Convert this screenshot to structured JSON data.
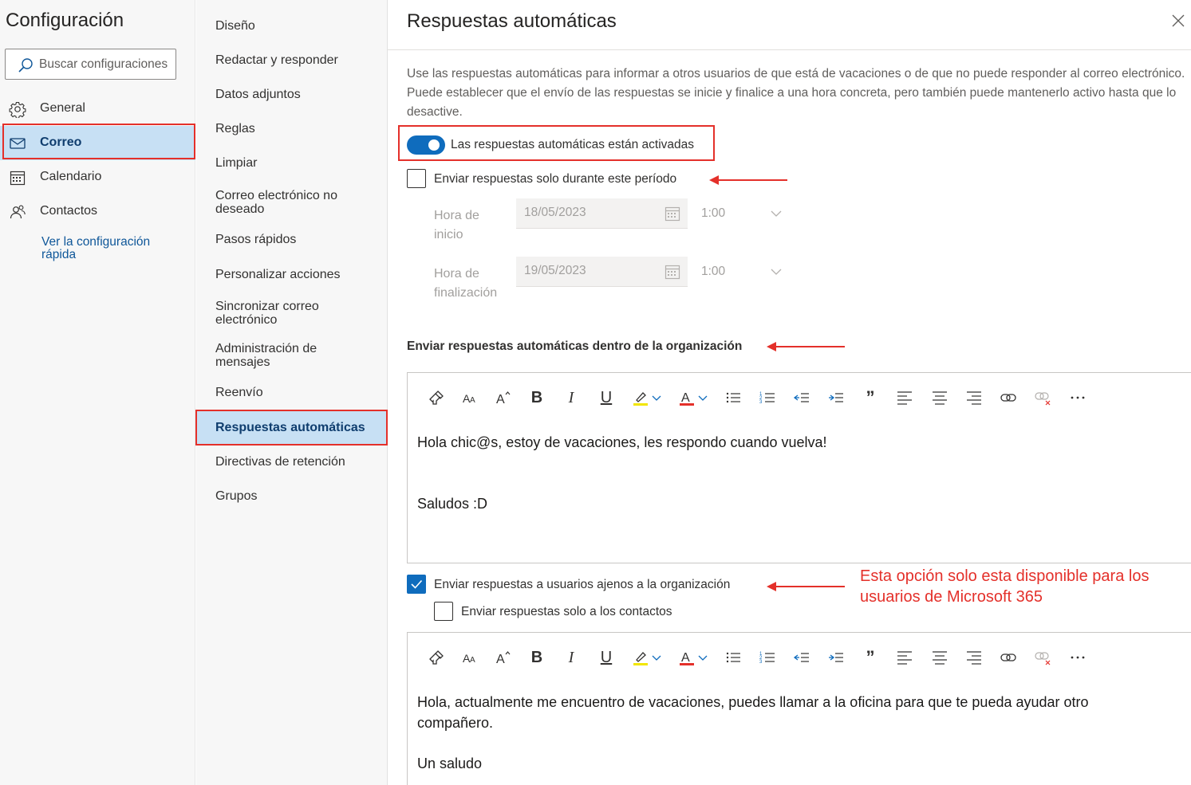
{
  "left": {
    "title": "Configuración",
    "search_placeholder": "Buscar configuraciones",
    "categories": [
      {
        "label": "General",
        "icon": "gear-icon"
      },
      {
        "label": "Correo",
        "icon": "mail-icon"
      },
      {
        "label": "Calendario",
        "icon": "calendar-icon"
      },
      {
        "label": "Contactos",
        "icon": "people-icon"
      }
    ],
    "quick_link": "Ver la configuración rápida"
  },
  "middle": {
    "items": [
      "Diseño",
      "Redactar y responder",
      "Datos adjuntos",
      "Reglas",
      "Limpiar",
      "Correo electrónico no deseado",
      "Pasos rápidos",
      "Personalizar acciones",
      "Sincronizar correo electrónico",
      "Administración de mensajes",
      "Reenvío",
      "Respuestas automáticas",
      "Directivas de retención",
      "Grupos"
    ]
  },
  "right": {
    "title": "Respuestas automáticas",
    "intro": "Use las respuestas automáticas para informar a otros usuarios de que está de vacaciones o de que no puede responder al correo electrónico. Puede establecer que el envío de las respuestas se inicie y finalice a una hora concreta, pero también puede mantenerlo activo hasta que lo desactive.",
    "toggle_label": "Las respuestas automáticas están activadas",
    "toggle_on": true,
    "period_label": "Enviar respuestas solo durante este período",
    "period_checked": false,
    "start_label": "Hora de inicio",
    "start_date": "18/05/2023",
    "start_time": "1:00",
    "end_label": "Hora de finalización",
    "end_date": "19/05/2023",
    "end_time": "1:00",
    "inside_title": "Enviar respuestas automáticas dentro de la organización",
    "inside_line1": "Hola chic@s, estoy de vacaciones, les respondo cuando vuelva!",
    "inside_line2": "Saludos :D",
    "outside_label": "Enviar respuestas a usuarios ajenos a la organización",
    "outside_checked": true,
    "contacts_label": "Enviar respuestas solo a los contactos",
    "contacts_checked": false,
    "outside_line1": "Hola, actualmente me encuentro de vacaciones, puedes llamar a la oficina para que te pueda ayudar otro compañero.",
    "outside_line2": "Un saludo"
  },
  "annotation": {
    "note": "Esta opción solo esta disponible para los usuarios de Microsoft 365",
    "color": "#e4302a"
  },
  "colors": {
    "accent": "#0f6cbd",
    "selected_bg": "#c7e0f4",
    "pane_bg": "#f7f7f7"
  },
  "toolbar_icons": [
    "format-painter-icon",
    "font-size-icon",
    "font-grow-icon",
    "bold-icon",
    "italic-icon",
    "underline-icon",
    "highlight-icon",
    "font-color-icon",
    "bullets-icon",
    "numbering-icon",
    "outdent-icon",
    "indent-icon",
    "quote-icon",
    "align-left-icon",
    "align-center-icon",
    "align-right-icon",
    "link-icon",
    "unlink-icon",
    "more-icon"
  ]
}
